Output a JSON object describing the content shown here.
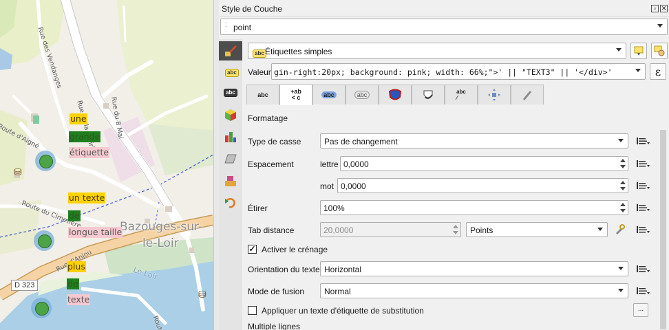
{
  "map": {
    "labels_group_1": [
      "une",
      "grande",
      "étiquette"
    ],
    "labels_group_2": [
      "un texte",
      "de",
      "longue taille"
    ],
    "labels_group_3": [
      "plus",
      "de",
      "texte"
    ],
    "place_name_line1": "Bazouges-sur-",
    "place_name_line2": "le-Loir",
    "road_labels": [
      "Rue des Vendanges",
      "Rue du 8 Mai",
      "Rue de la Prairie",
      "Route d'Aigné",
      "Route du Cimetière",
      "Rue d'Anjou",
      "Le Loir",
      "Route"
    ],
    "road_shield": "D 323"
  },
  "panel": {
    "title": "Style de Couche",
    "layer_combo": "point",
    "renderer_combo": "Étiquettes simples",
    "value_label": "Valeur",
    "value_expression": "gin-right:20px; background: pink; width: 66%;\">' || \"TEXT3\" || '</div>'",
    "expression_btn": "ε",
    "section_title": "Formatage",
    "type_casse_label": "Type de casse",
    "type_casse_value": "Pas de changement",
    "espacement_label": "Espacement",
    "lettre_label": "lettre",
    "lettre_value": "0,0000",
    "mot_label": "mot",
    "mot_value": "0,0000",
    "etirer_label": "Étirer",
    "etirer_value": "100%",
    "tab_distance_label": "Tab distance",
    "tab_distance_value": "20,0000",
    "tab_distance_unit": "Points",
    "crenage_label": "Activer le crénage",
    "crenage_checked": "✓",
    "orientation_label": "Orientation du texte",
    "orientation_value": "Horizontal",
    "fusion_label": "Mode de fusion",
    "fusion_value": "Normal",
    "substitution_label": "Appliquer un texte d'étiquette de substitution",
    "substitution_btn": "...",
    "multiline_label": "Multiple lignes",
    "abc_badge": "abc"
  },
  "colors": {
    "label_yellow": "#ffd200",
    "label_green": "#1f7f1f",
    "label_pink": "#f6c9d0",
    "poi_green": "#4da447"
  }
}
